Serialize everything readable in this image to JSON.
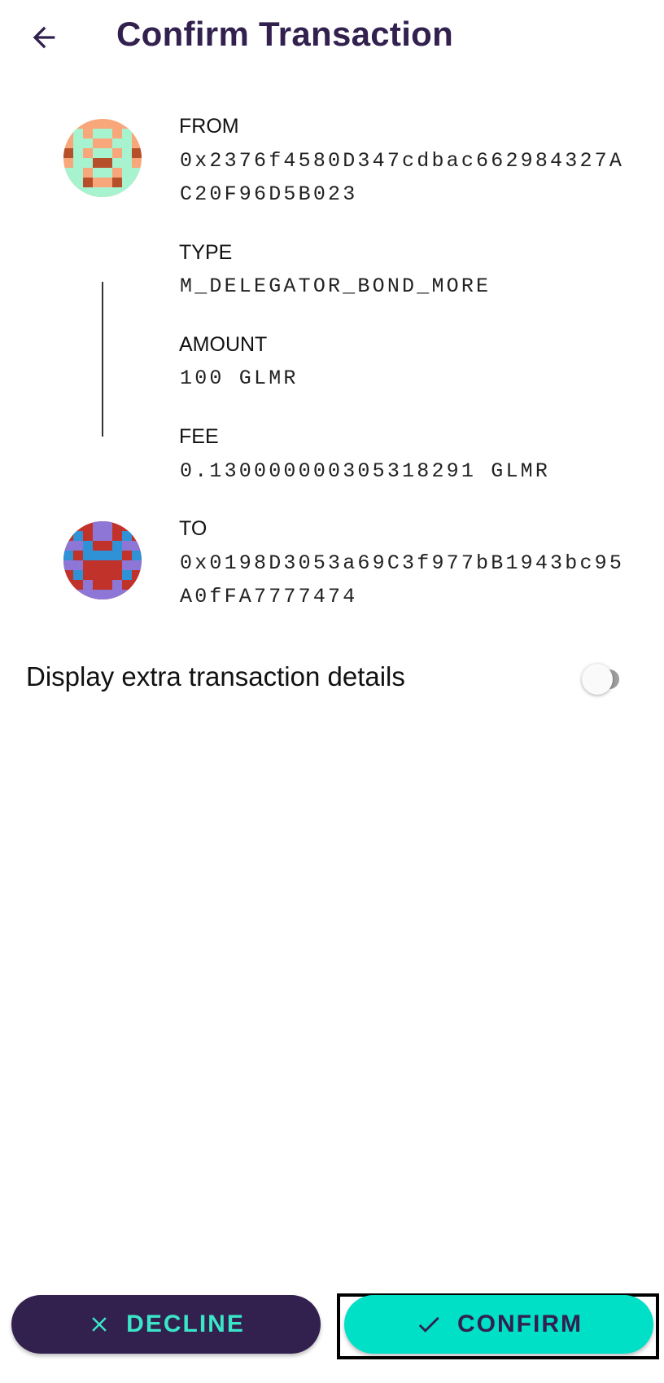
{
  "header": {
    "title": "Confirm Transaction",
    "back_icon": "arrow-left-icon"
  },
  "transaction": {
    "from": {
      "label": "FROM",
      "value": "0x2376f4580D347cdbac662984327AC20F96D5B023",
      "avatar_icon": "identicon-avatar"
    },
    "type": {
      "label": "TYPE",
      "value": "M_DELEGATOR_BOND_MORE"
    },
    "amount": {
      "label": "AMOUNT",
      "value": "100 GLMR"
    },
    "fee": {
      "label": "FEE",
      "value": "0.130000000305318291 GLMR"
    },
    "to": {
      "label": "TO",
      "value": "0x0198D3053a69C3f977bB1943bc95A0fFA7777474",
      "avatar_icon": "identicon-avatar"
    }
  },
  "extra_details": {
    "label": "Display extra transaction details",
    "enabled": false
  },
  "actions": {
    "decline_label": "DECLINE",
    "decline_icon": "close-icon",
    "confirm_label": "CONFIRM",
    "confirm_icon": "checkmark-icon"
  },
  "colors": {
    "brand_purple": "#32204e",
    "accent_teal": "#00e0c6",
    "decline_text": "#3ae6c8",
    "toggle_track_off": "#9e9e9e",
    "from_avatar": [
      "#f8a77a",
      "#a8f3cf",
      "#b5502a"
    ],
    "to_avatar": [
      "#c1322a",
      "#8e76d6",
      "#2f91d6"
    ]
  }
}
